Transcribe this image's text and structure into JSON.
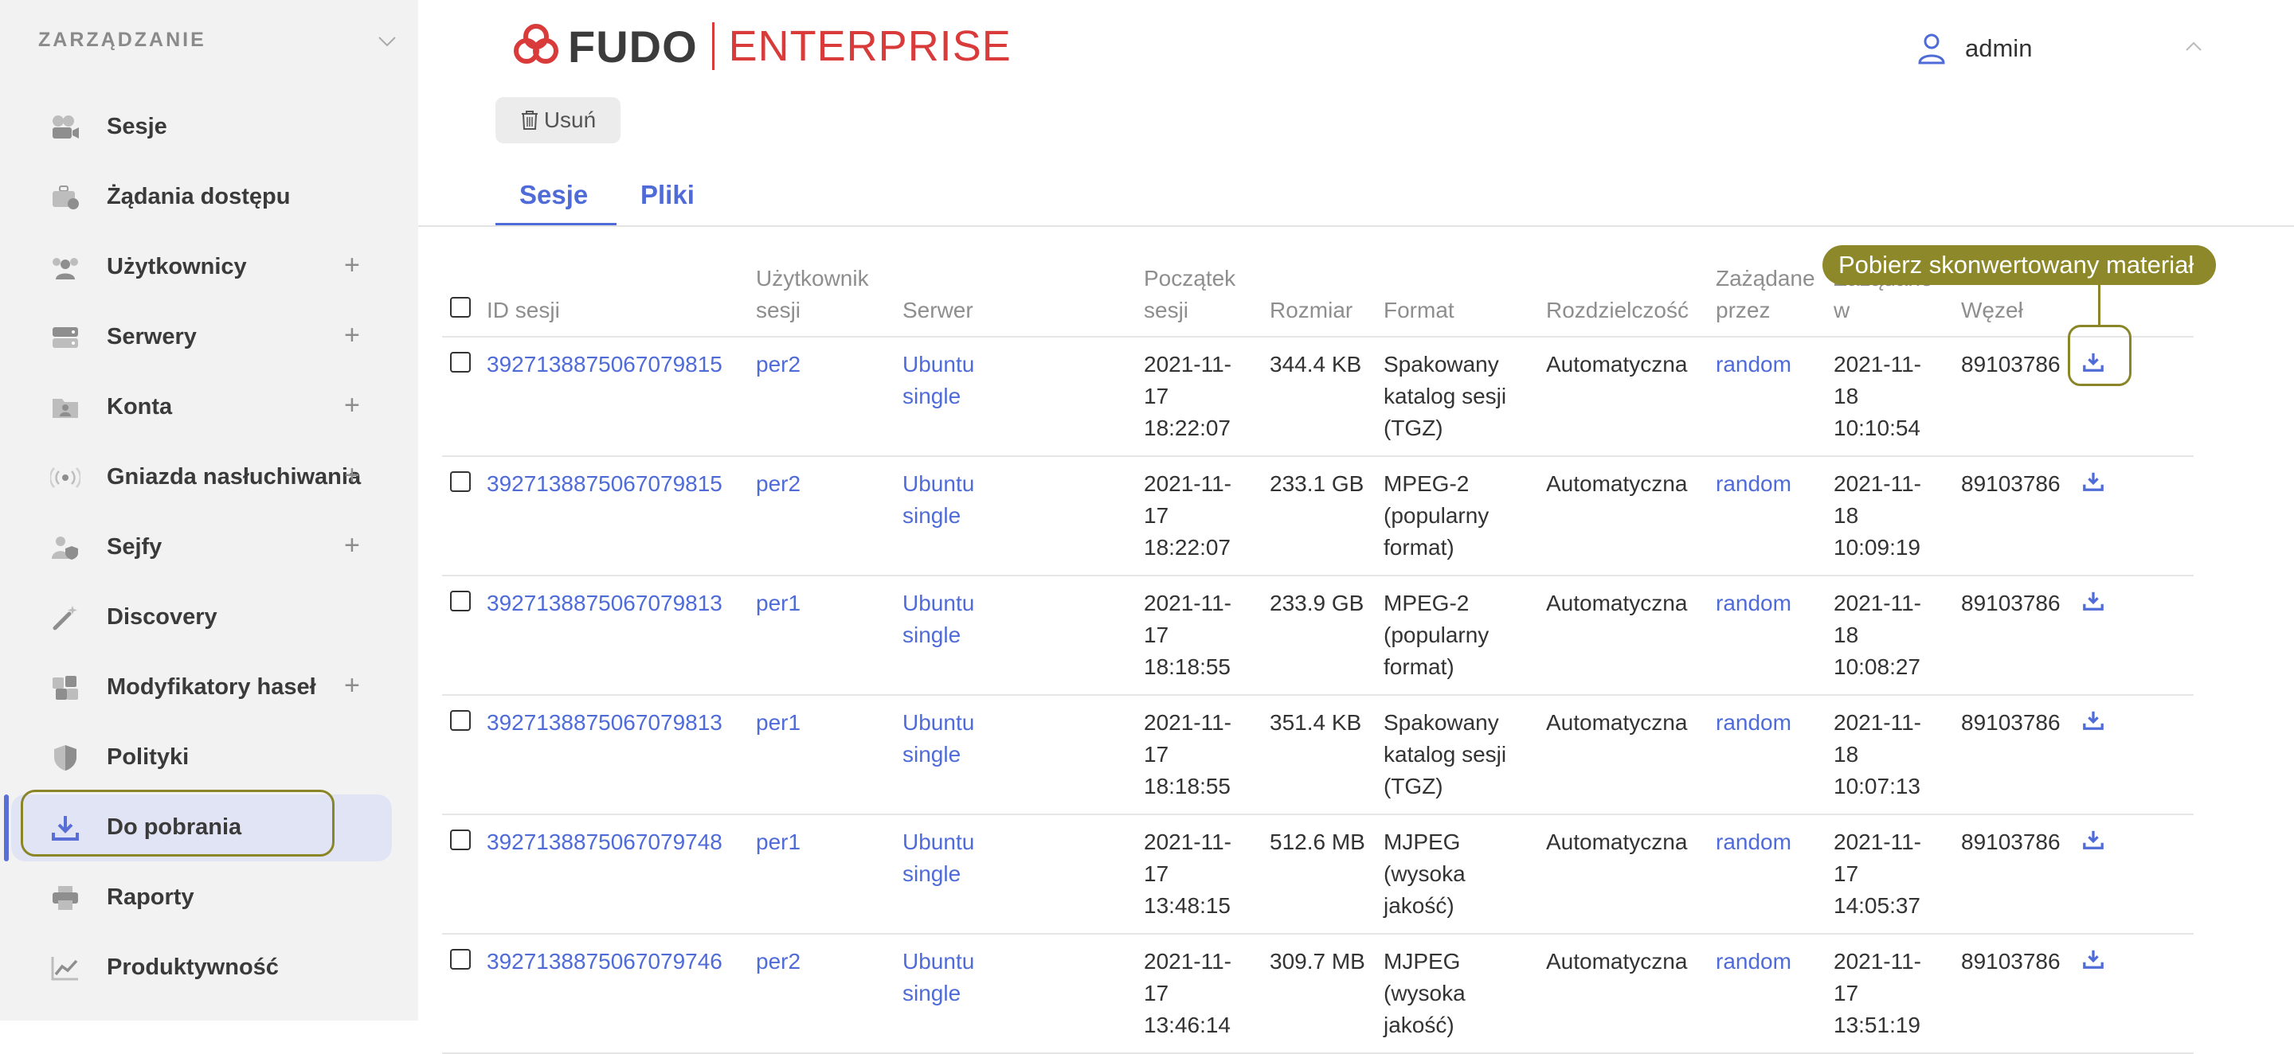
{
  "sidebar": {
    "section_title": "ZARZĄDZANIE",
    "items": [
      {
        "label": "Sesje",
        "icon": "camera-icon",
        "expandable": false
      },
      {
        "label": "Żądania dostępu",
        "icon": "briefcase-clock-icon",
        "expandable": false
      },
      {
        "label": "Użytkownicy",
        "icon": "users-icon",
        "expandable": true
      },
      {
        "label": "Serwery",
        "icon": "server-icon",
        "expandable": true
      },
      {
        "label": "Konta",
        "icon": "folder-user-icon",
        "expandable": true
      },
      {
        "label": "Gniazda nasłuchiwania",
        "icon": "broadcast-icon",
        "expandable": true
      },
      {
        "label": "Sejfy",
        "icon": "user-shield-icon",
        "expandable": true
      },
      {
        "label": "Discovery",
        "icon": "magic-wand-icon",
        "expandable": false
      },
      {
        "label": "Modyfikatory haseł",
        "icon": "puzzle-icon",
        "expandable": true
      },
      {
        "label": "Polityki",
        "icon": "shield-icon",
        "expandable": false
      },
      {
        "label": "Do pobrania",
        "icon": "download-icon",
        "expandable": false,
        "active": true
      },
      {
        "label": "Raporty",
        "icon": "printer-icon",
        "expandable": false
      },
      {
        "label": "Produktywność",
        "icon": "chart-line-icon",
        "expandable": false
      }
    ]
  },
  "header": {
    "logo_main": "FUDO",
    "logo_sub": "ENTERPRISE",
    "username": "admin"
  },
  "toolbar": {
    "delete_label": "Usuń"
  },
  "tabs": [
    {
      "label": "Sesje",
      "active": true
    },
    {
      "label": "Pliki",
      "active": false
    }
  ],
  "table": {
    "columns": {
      "session_id": "ID sesji",
      "user_1": "Użytkownik",
      "user_2": "sesji",
      "server": "Serwer",
      "start_1": "Początek",
      "start_2": "sesji",
      "size": "Rozmiar",
      "format": "Format",
      "resolution": "Rozdzielczość",
      "requested_by_1": "Zażądane",
      "requested_by_2": "przez",
      "requested_at_1": "Zażądane",
      "requested_at_2": "w",
      "node": "Węzeł"
    },
    "rows": [
      {
        "id": "3927138875067079815",
        "user": "per2",
        "server_1": "Ubuntu",
        "server_2": "single",
        "start_1": "2021-11-",
        "start_2": "17",
        "start_3": "18:22:07",
        "size": "344.4 KB",
        "format_1": "Spakowany",
        "format_2": "katalog sesji",
        "format_3": "(TGZ)",
        "resolution": "Automatyczna",
        "requested_by": "random",
        "req_1": "2021-11-",
        "req_2": "18",
        "req_3": "10:10:54",
        "node": "89103786"
      },
      {
        "id": "3927138875067079815",
        "user": "per2",
        "server_1": "Ubuntu",
        "server_2": "single",
        "start_1": "2021-11-",
        "start_2": "17",
        "start_3": "18:22:07",
        "size": "233.1 GB",
        "format_1": "MPEG-2",
        "format_2": "(popularny",
        "format_3": "format)",
        "resolution": "Automatyczna",
        "requested_by": "random",
        "req_1": "2021-11-",
        "req_2": "18",
        "req_3": "10:09:19",
        "node": "89103786"
      },
      {
        "id": "3927138875067079813",
        "user": "per1",
        "server_1": "Ubuntu",
        "server_2": "single",
        "start_1": "2021-11-",
        "start_2": "17",
        "start_3": "18:18:55",
        "size": "233.9 GB",
        "format_1": "MPEG-2",
        "format_2": "(popularny",
        "format_3": "format)",
        "resolution": "Automatyczna",
        "requested_by": "random",
        "req_1": "2021-11-",
        "req_2": "18",
        "req_3": "10:08:27",
        "node": "89103786"
      },
      {
        "id": "3927138875067079813",
        "user": "per1",
        "server_1": "Ubuntu",
        "server_2": "single",
        "start_1": "2021-11-",
        "start_2": "17",
        "start_3": "18:18:55",
        "size": "351.4 KB",
        "format_1": "Spakowany",
        "format_2": "katalog sesji",
        "format_3": "(TGZ)",
        "resolution": "Automatyczna",
        "requested_by": "random",
        "req_1": "2021-11-",
        "req_2": "18",
        "req_3": "10:07:13",
        "node": "89103786"
      },
      {
        "id": "3927138875067079748",
        "user": "per1",
        "server_1": "Ubuntu",
        "server_2": "single",
        "start_1": "2021-11-",
        "start_2": "17",
        "start_3": "13:48:15",
        "size": "512.6 MB",
        "format_1": "MJPEG",
        "format_2": "(wysoka",
        "format_3": "jakość)",
        "resolution": "Automatyczna",
        "requested_by": "random",
        "req_1": "2021-11-",
        "req_2": "17",
        "req_3": "14:05:37",
        "node": "89103786"
      },
      {
        "id": "3927138875067079746",
        "user": "per2",
        "server_1": "Ubuntu",
        "server_2": "single",
        "start_1": "2021-11-",
        "start_2": "17",
        "start_3": "13:46:14",
        "size": "309.7 MB",
        "format_1": "MJPEG",
        "format_2": "(wysoka",
        "format_3": "jakość)",
        "resolution": "Automatyczna",
        "requested_by": "random",
        "req_1": "2021-11-",
        "req_2": "17",
        "req_3": "13:51:19",
        "node": "89103786"
      }
    ]
  },
  "tooltip": {
    "text": "Pobierz skonwertowany materiał"
  },
  "colors": {
    "accent": "#4f6bd8",
    "brand_red": "#d93a3a",
    "highlight": "#8d8829"
  }
}
